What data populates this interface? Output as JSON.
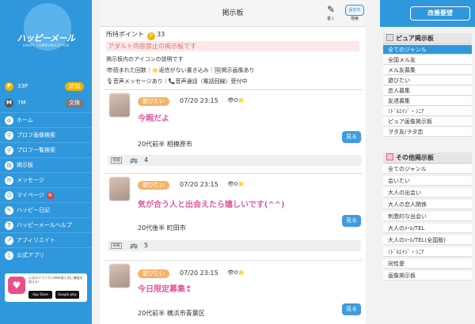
{
  "left": {
    "logo": {
      "name": "ハッピーメール",
      "sub": "HAPPY COMMUNICATION"
    },
    "points": {
      "icon": "P",
      "value": "33P",
      "button": "追加"
    },
    "mileage": {
      "icon": "M",
      "value": "7M",
      "button": "交換"
    },
    "nav": [
      {
        "label": "ホーム",
        "icon": "house-icon"
      },
      {
        "label": "プロフ画像検索",
        "icon": "image-search-icon"
      },
      {
        "label": "プロフ一覧検索",
        "icon": "list-search-icon"
      },
      {
        "label": "掲示板",
        "icon": "board-icon"
      },
      {
        "label": "メッセージ",
        "icon": "message-icon"
      },
      {
        "label": "マイページ",
        "icon": "user-icon",
        "badge": "N"
      },
      {
        "label": "ハッピー日記",
        "icon": "diary-icon"
      },
      {
        "label": "ハッピーメールヘルプ",
        "icon": "help-icon"
      },
      {
        "label": "アフィリエイト",
        "icon": "affiliate-icon"
      },
      {
        "label": "公式アプリ",
        "icon": "app-icon"
      }
    ],
    "app_box": {
      "desc": "公式のアプリからWeb版と同じ機能を使える！",
      "app_store": "App Store",
      "google_play": "Google play"
    }
  },
  "header": {
    "title": "掲示板",
    "write": "書く",
    "search": "検索"
  },
  "notice": {
    "points_label": "所持ポイント",
    "points_value": "33",
    "adult": "アダルト内容禁止の掲示板です",
    "icons_help": "掲示板内のアイコンの説明です",
    "line1": "👁読まれた回数｜⭐返信がない書き込み｜🖼掲示画像あり",
    "line2": "🎙音声メッセージあり｜📞音声通話（電話回線）受付中"
  },
  "posts": [
    {
      "tag": "遊びたい",
      "time": "07/20 23:15",
      "meta": "👁0⭐",
      "title": "今暇だよ",
      "loc": "20代前半 相模原市",
      "see": "見る",
      "bar_label": "掲載",
      "count": "4"
    },
    {
      "tag": "遊びたい",
      "time": "07/20 23:15",
      "meta": "👁0⭐",
      "title": "気が合う人と出会えたら嬉しいです(^^)",
      "loc": "20代後半 町田市",
      "see": "見る",
      "bar_label": "掲載",
      "count": "5"
    },
    {
      "tag": "遊びたい",
      "time": "07/20 23:15",
      "meta": "👁0⭐",
      "title": "今日限定募集❢",
      "loc": "20代前半 横浜市青葉区",
      "see": "見る"
    }
  ],
  "right": {
    "request_button": "改善要望",
    "pure_title": "ピュア掲示板",
    "pure_items": [
      "全てのジャンル",
      "全国メル友",
      "メル友募集",
      "遊びたい",
      "恋人募集",
      "友達募集",
      "ﾐﾄﾞﾙｴｲｼﾞ・ｼﾆｱ",
      "ピュア画像掲示板",
      "ヲタ友/ヲタ恋"
    ],
    "other_title": "その他掲示板",
    "other_items": [
      "全てのジャンル",
      "会いたい",
      "大人の出会い",
      "大人の恋人関係",
      "刺激的な出会い",
      "大人のﾒｰﾙ/TEL",
      "大人のﾒｰﾙ/TEL(全国版)",
      "ﾐﾄﾞﾙｴｲｼﾞ・ｼﾆｱ",
      "同性愛",
      "画像掲示板"
    ]
  },
  "colors": {
    "brand_blue": "#2f97db",
    "pink_title": "#e05aa0",
    "tag_orange": "#f6b26b"
  }
}
